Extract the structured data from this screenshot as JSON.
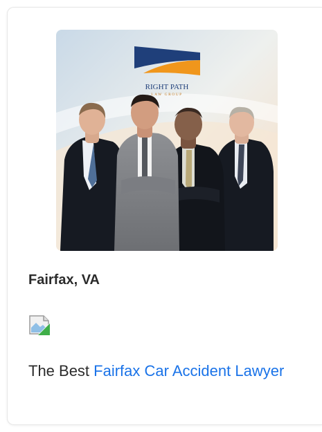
{
  "card": {
    "image_alt": "Right Path Law Group attorneys",
    "logo": {
      "line1": "RIGHT PATH",
      "line2": "LAW GROUP"
    },
    "location": "Fairfax, VA",
    "broken_image_icon": "broken-image-icon",
    "description_prefix": "The Best ",
    "link_text": "Fairfax Car Accident Lawyer"
  },
  "colors": {
    "link": "#1a73e8",
    "logo_navy": "#1f3f7a",
    "logo_orange": "#f0961c"
  }
}
